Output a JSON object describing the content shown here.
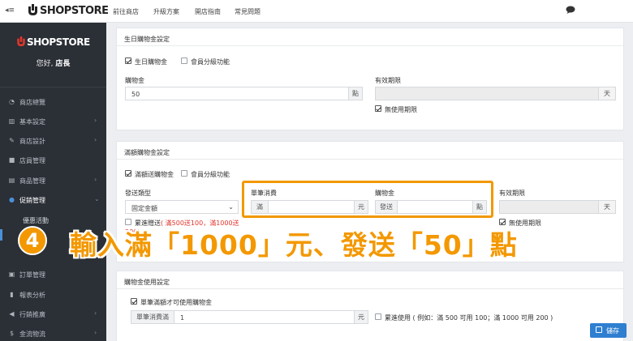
{
  "topbar": {
    "logo": "SHOPSTORE",
    "nav": [
      "前往商店",
      "升級方案",
      "開店指南",
      "常見問題"
    ]
  },
  "sidebar": {
    "brand": "SHOPSTORE",
    "greeting_prefix": "您好, ",
    "greeting_name": "店長",
    "items": [
      {
        "icon": "dashboard-icon",
        "label": "商店總覽"
      },
      {
        "icon": "bank-icon",
        "label": "基本設定"
      },
      {
        "icon": "brush-icon",
        "label": "商店設計"
      },
      {
        "icon": "lock-icon",
        "label": "店員管理"
      },
      {
        "icon": "cart-icon",
        "label": "商品管理"
      },
      {
        "icon": "promo-icon",
        "label": "促銷管理"
      },
      {
        "icon": "",
        "label": "優惠活動"
      },
      {
        "icon": "order-icon",
        "label": "訂單管理"
      },
      {
        "icon": "chart-icon",
        "label": "報表分析"
      },
      {
        "icon": "megaphone-icon",
        "label": "行銷推廣"
      },
      {
        "icon": "dollar-icon",
        "label": "金流物流"
      }
    ]
  },
  "birthday_panel": {
    "title": "生日購物金設定",
    "enable_label": "生日購物金",
    "member_level_label": "會員分級功能",
    "amount_label": "購物金",
    "amount_value": "50",
    "amount_unit": "點",
    "expiry_label": "有效期限",
    "expiry_unit": "天",
    "no_expiry_label": "無使用期限"
  },
  "threshold_panel": {
    "title": "滿額購物金設定",
    "enable_label": "滿額送購物金",
    "member_level_label": "會員分級功能",
    "type_label": "發送類型",
    "type_value": "固定金額",
    "spend_label": "單筆消費",
    "spend_prefix": "滿",
    "spend_unit": "元",
    "give_label": "購物金",
    "give_prefix": "發送",
    "give_unit": "點",
    "expiry_label": "有效期限",
    "expiry_unit": "天",
    "cumulative_label": "累進贈送",
    "cumulative_note": "( 滿500送100，滿1000送",
    "cumulative_note2": "200)",
    "no_expiry_label": "無使用期限"
  },
  "usage_panel": {
    "title": "購物金使用設定",
    "min_order_label": "單筆滿額才可使用購物金",
    "min_order_prefix": "單筆消費滿",
    "min_order_value": "1",
    "min_order_unit": "元",
    "cumulative_label": "累進使用 ( 例如：滿 500 可用 100；滿 1000 可用 200 )"
  },
  "caption": {
    "step": "4",
    "text": "輸入滿「1000」元、發送「50」點"
  },
  "save_label": "儲存",
  "colors": {
    "accent": "#f39800",
    "primary": "#2f7fd1",
    "sidebar": "#2b2f36"
  }
}
